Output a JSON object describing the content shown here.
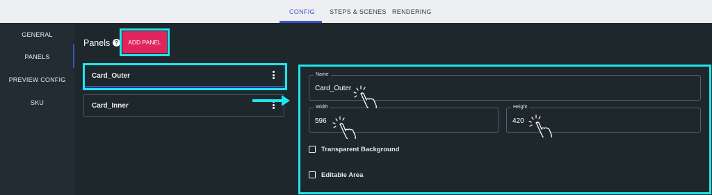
{
  "tabs": [
    {
      "label": "CONFIG",
      "active": true
    },
    {
      "label": "STEPS & SCENES",
      "active": false
    },
    {
      "label": "RENDERING",
      "active": false
    }
  ],
  "sidebar": {
    "items": [
      {
        "label": "GENERAL",
        "active": false
      },
      {
        "label": "PANELS",
        "active": true
      },
      {
        "label": "PREVIEW CONFIG",
        "active": false
      },
      {
        "label": "SKU",
        "active": false
      }
    ]
  },
  "panels": {
    "title": "Panels",
    "help_icon": "question-circle-icon",
    "add_button_label": "ADD PANEL",
    "list": [
      {
        "label": "Card_Outer",
        "selected": true
      },
      {
        "label": "Card_Inner",
        "selected": false
      }
    ]
  },
  "form": {
    "name": {
      "label": "Name",
      "value": "Card_Outer"
    },
    "width": {
      "label": "Width",
      "value": "596"
    },
    "height": {
      "label": "Height",
      "value": "420"
    },
    "transparent_background": {
      "label": "Transparent Background",
      "checked": false
    },
    "editable_area": {
      "label": "Editable Area",
      "checked": false
    }
  },
  "colors": {
    "accent_blue": "#3b57c4",
    "highlight_cyan": "#1ee6ee",
    "add_button_pink": "#e0245e",
    "background_dark": "#1e272c"
  }
}
